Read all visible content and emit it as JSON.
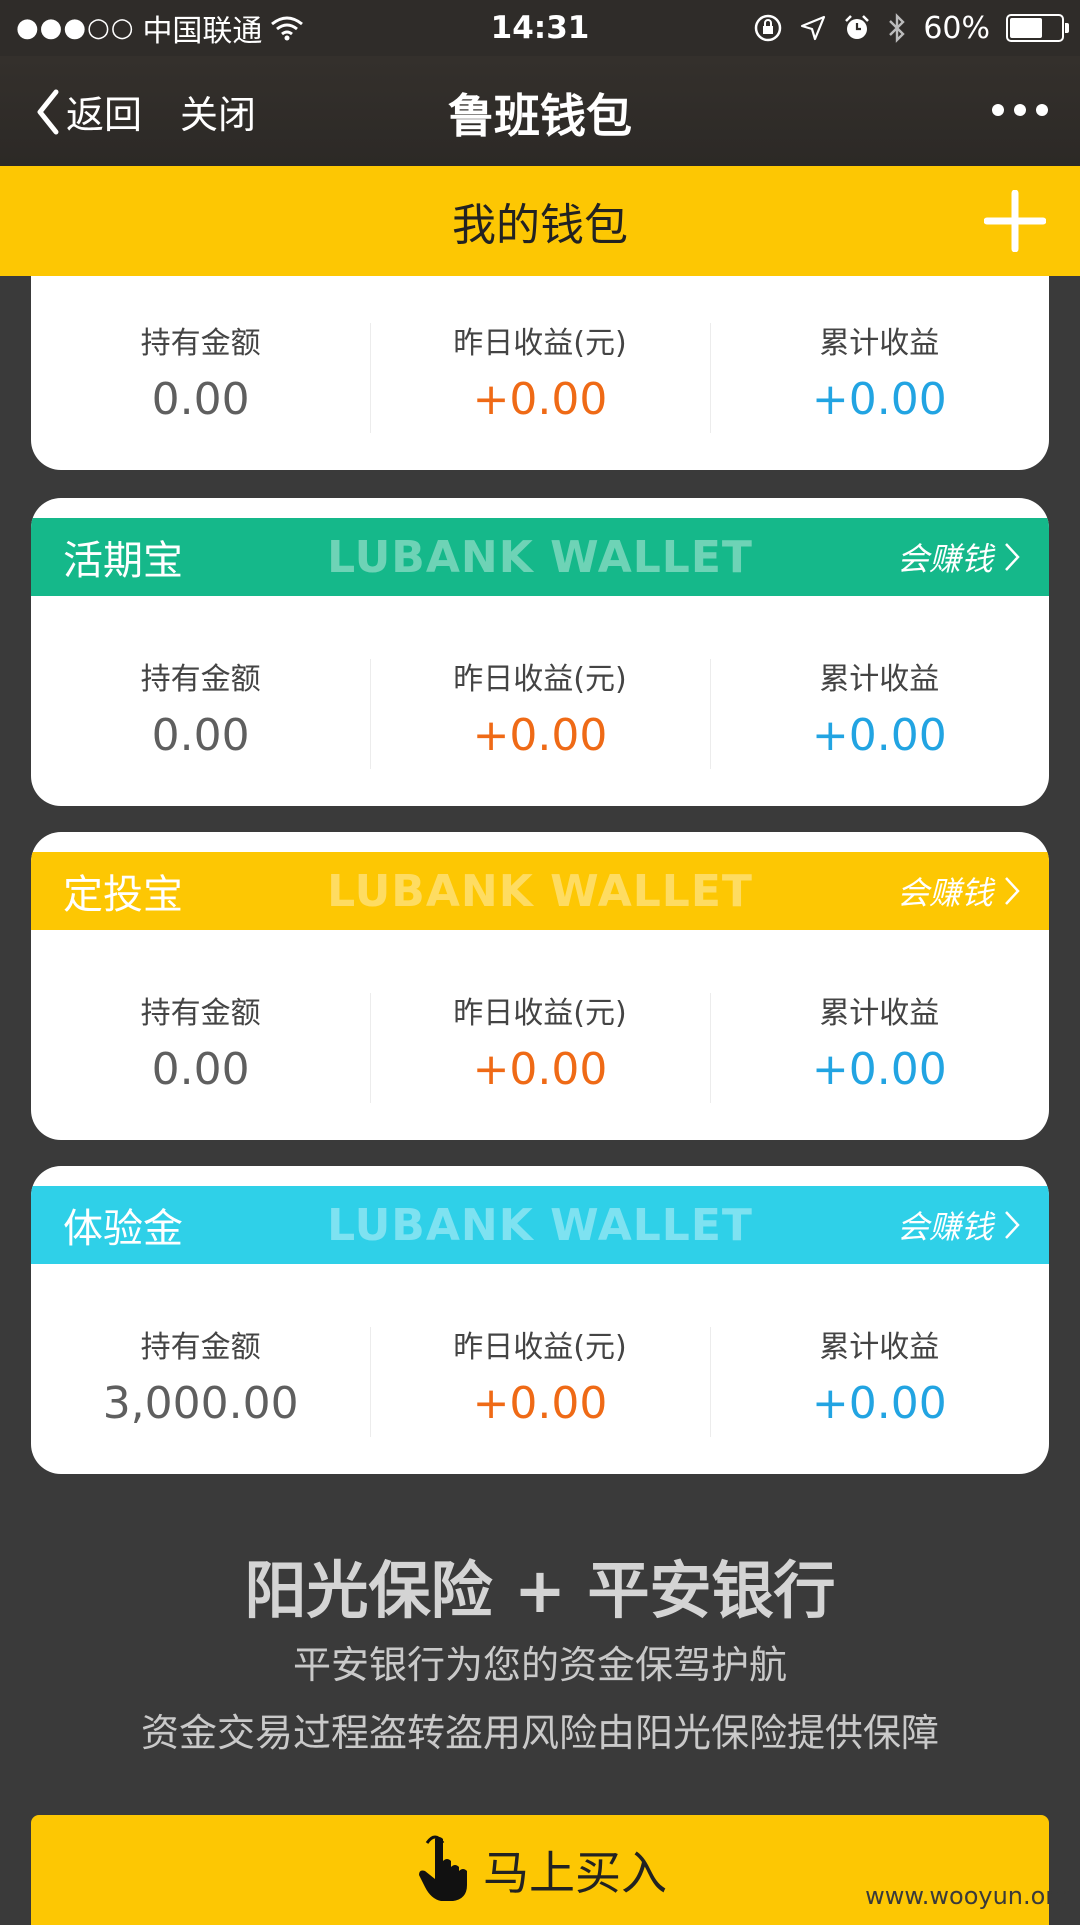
{
  "status_bar": {
    "carrier": "中国联通",
    "time": "14:31",
    "battery_percent": "60%",
    "battery_level": 0.6
  },
  "nav": {
    "back_label": "返回",
    "close_label": "关闭",
    "title": "鲁班钱包"
  },
  "wallet_header": {
    "title": "我的钱包"
  },
  "stat_labels": {
    "holding": "持有金额",
    "yesterday": "昨日收益(元)",
    "total": "累计收益"
  },
  "cards": [
    {
      "name": "",
      "watermark": "",
      "link": "",
      "color": "#ffffff",
      "holding": "0.00",
      "yesterday": "+0.00",
      "total": "+0.00"
    },
    {
      "name": "活期宝",
      "watermark": "LUBANK WALLET",
      "link": "会赚钱",
      "color": "#15b88a",
      "holding": "0.00",
      "yesterday": "+0.00",
      "total": "+0.00"
    },
    {
      "name": "定投宝",
      "watermark": "LUBANK WALLET",
      "link": "会赚钱",
      "color": "#fdc703",
      "holding": "0.00",
      "yesterday": "+0.00",
      "total": "+0.00"
    },
    {
      "name": "体验金",
      "watermark": "LUBANK WALLET",
      "link": "会赚钱",
      "color": "#2fd0e8",
      "holding": "3,000.00",
      "yesterday": "+0.00",
      "total": "+0.00"
    }
  ],
  "promo": {
    "title": "阳光保险 + 平安银行",
    "line1": "平安银行为您的资金保驾护航",
    "line2": "资金交易过程盗转盗用风险由阳光保险提供保障"
  },
  "buy_button": {
    "label": "马上买入"
  },
  "watermark_text": "www.wooyun.org",
  "colors": {
    "accent": "#fdc703",
    "orange": "#ef6a16",
    "blue": "#22a4e2"
  }
}
